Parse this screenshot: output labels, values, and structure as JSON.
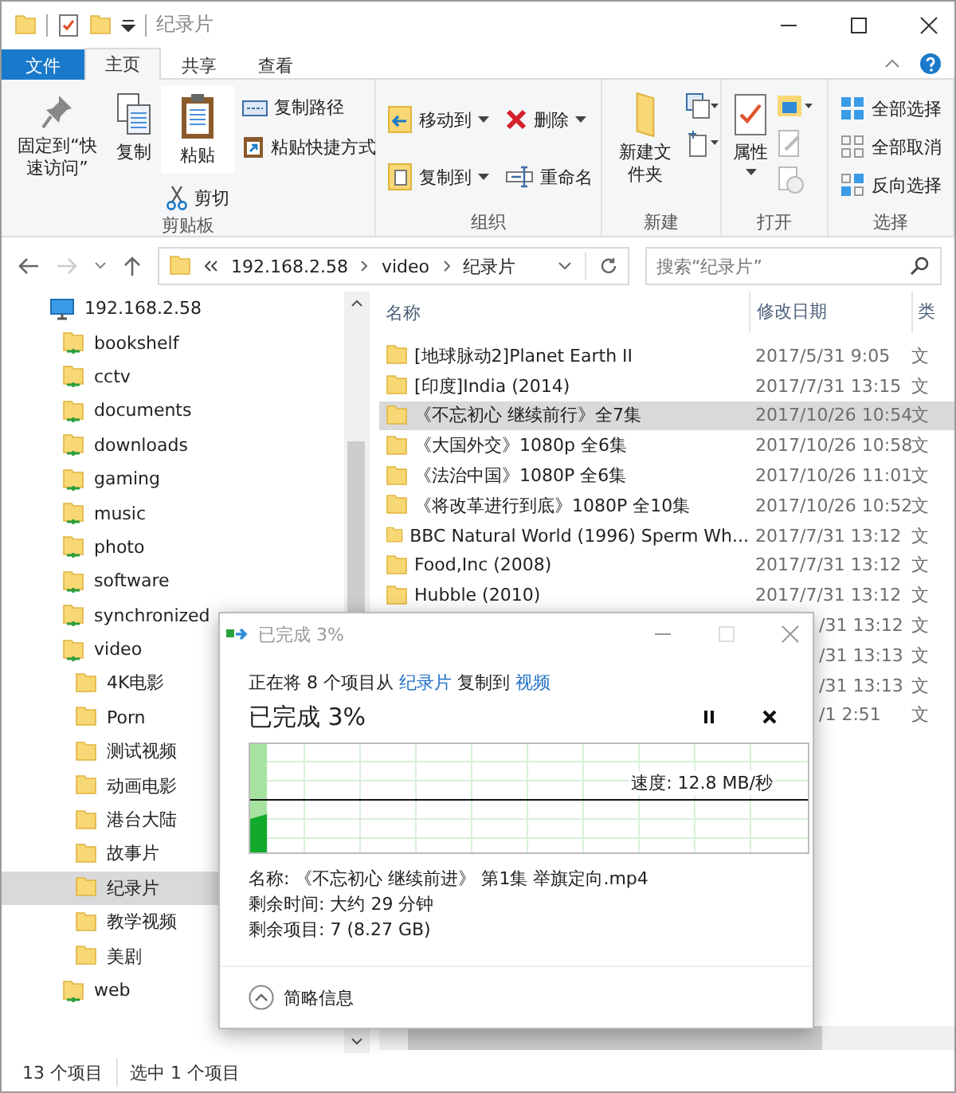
{
  "window": {
    "title": "纪录片"
  },
  "ribbon_tabs": [
    {
      "label": "文件",
      "kind": "file",
      "selected": false
    },
    {
      "label": "主页",
      "kind": "tab",
      "selected": true
    },
    {
      "label": "共享",
      "kind": "tab",
      "selected": false
    },
    {
      "label": "查看",
      "kind": "tab",
      "selected": false
    }
  ],
  "ribbon": {
    "clipboard": {
      "label": "剪贴板",
      "pin": "固定到“快速访问”",
      "copy": "复制",
      "paste": "粘贴",
      "copy_path": "复制路径",
      "paste_shortcut": "粘贴快捷方式",
      "cut": "剪切"
    },
    "organize": {
      "label": "组织",
      "move_to": "移动到",
      "delete": "删除",
      "copy_to": "复制到",
      "rename": "重命名"
    },
    "new": {
      "label": "新建",
      "new_folder": "新建文件夹"
    },
    "open": {
      "label": "打开",
      "properties": "属性"
    },
    "select": {
      "label": "选择",
      "select_all": "全部选择",
      "select_none": "全部取消",
      "invert": "反向选择"
    }
  },
  "address": {
    "path": [
      "192.168.2.58",
      "video",
      "纪录片"
    ],
    "search_placeholder": "搜索“纪录片”"
  },
  "nav": [
    {
      "label": "192.168.2.58",
      "kind": "computer",
      "selected": false,
      "children": [
        {
          "label": "bookshelf",
          "kind": "share",
          "selected": false
        },
        {
          "label": "cctv",
          "kind": "share",
          "selected": false
        },
        {
          "label": "documents",
          "kind": "share",
          "selected": false
        },
        {
          "label": "downloads",
          "kind": "share",
          "selected": false
        },
        {
          "label": "gaming",
          "kind": "share",
          "selected": false
        },
        {
          "label": "music",
          "kind": "share",
          "selected": false
        },
        {
          "label": "photo",
          "kind": "share",
          "selected": false
        },
        {
          "label": "software",
          "kind": "share",
          "selected": false
        },
        {
          "label": "synchronized",
          "kind": "share",
          "selected": false
        },
        {
          "label": "video",
          "kind": "share",
          "selected": false,
          "children": [
            {
              "label": "4K电影",
              "kind": "folder",
              "selected": false
            },
            {
              "label": "Porn",
              "kind": "folder",
              "selected": false
            },
            {
              "label": "测试视频",
              "kind": "folder",
              "selected": false
            },
            {
              "label": "动画电影",
              "kind": "folder",
              "selected": false
            },
            {
              "label": "港台大陆",
              "kind": "folder",
              "selected": false
            },
            {
              "label": "故事片",
              "kind": "folder",
              "selected": false
            },
            {
              "label": "纪录片",
              "kind": "folder",
              "selected": true
            },
            {
              "label": "教学视频",
              "kind": "folder",
              "selected": false
            },
            {
              "label": "美剧",
              "kind": "folder",
              "selected": false
            }
          ]
        },
        {
          "label": "web",
          "kind": "share",
          "selected": false
        }
      ]
    }
  ],
  "table": {
    "columns": [
      "名称",
      "修改日期",
      "类"
    ],
    "rows": [
      {
        "name": "[地球脉动2]Planet Earth II",
        "date": "2017/5/31 9:05",
        "type": "文",
        "selected": false
      },
      {
        "name": "[印度]India (2014)",
        "date": "2017/7/31 13:15",
        "type": "文",
        "selected": false
      },
      {
        "name": "《不忘初心 继续前行》全7集",
        "date": "2017/10/26 10:54",
        "type": "文",
        "selected": true
      },
      {
        "name": "《大国外交》1080p 全6集",
        "date": "2017/10/26 10:58",
        "type": "文",
        "selected": false
      },
      {
        "name": "《法治中国》1080P 全6集",
        "date": "2017/10/26 11:01",
        "type": "文",
        "selected": false
      },
      {
        "name": "《将改革进行到底》1080P 全10集",
        "date": "2017/10/26 10:52",
        "type": "文",
        "selected": false
      },
      {
        "name": "BBC Natural World (1996) Sperm Wh...",
        "date": "2017/7/31 13:12",
        "type": "文",
        "selected": false
      },
      {
        "name": "Food,Inc (2008)",
        "date": "2017/7/31 13:12",
        "type": "文",
        "selected": false
      },
      {
        "name": "Hubble (2010)",
        "date": "2017/7/31 13:12",
        "type": "文",
        "selected": false
      },
      {
        "date": "/31 13:12",
        "type": "文",
        "selected": false
      },
      {
        "date": "/31 13:13",
        "type": "文",
        "selected": false
      },
      {
        "date": "/31 13:13",
        "type": "文",
        "selected": false
      },
      {
        "date": "/1 2:51",
        "type": "文",
        "selected": false
      }
    ]
  },
  "status_bar": {
    "count": "13 个项目",
    "selection": "选中 1 个项目"
  },
  "dialog": {
    "title": "已完成 3%",
    "line_before": "正在将 8 个项目从",
    "source": "纪录片",
    "line_middle": "复制到",
    "target": "视频",
    "heading": "已完成 3%",
    "level": 0.03,
    "speed": "速度: 12.8 MB/秒",
    "details": [
      "名称: 《不忘初心 继续前进》 第1集 举旗定向.mp4",
      "剩余时间: 大约 29 分钟",
      "剩余项目: 7 (8.27 GB)"
    ],
    "toggle": "简略信息"
  }
}
